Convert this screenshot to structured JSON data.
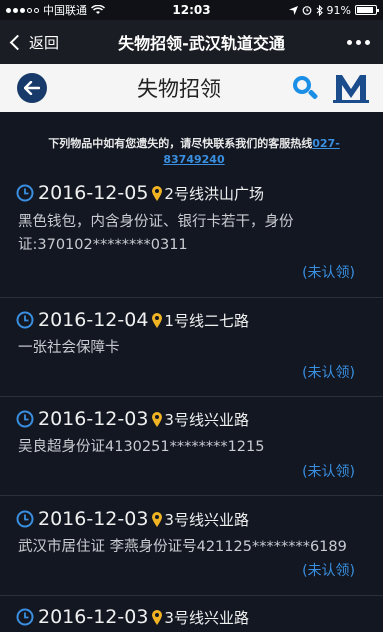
{
  "status_bar": {
    "carrier": "中国联通",
    "time": "12:03",
    "battery": "91%",
    "battery_level": 0.91
  },
  "nav": {
    "back_label": "返回",
    "title": "失物招领-武汉轨道交通"
  },
  "header": {
    "title": "失物招领"
  },
  "notice": {
    "text": "下列物品中如有您遗失的，请尽快联系我们的客服热线",
    "hotline": "027-83749240"
  },
  "items": [
    {
      "date": "2016-12-05",
      "location": "2号线洪山广场",
      "description": "黑色钱包，内含身份证、银行卡若干，身份证:370102********0311",
      "status": "(未认领)"
    },
    {
      "date": "2016-12-04",
      "location": "1号线二七路",
      "description": "一张社会保障卡",
      "status": "(未认领)"
    },
    {
      "date": "2016-12-03",
      "location": "3号线兴业路",
      "description": "吴良超身份证4130251********1215",
      "status": "(未认领)"
    },
    {
      "date": "2016-12-03",
      "location": "3号线兴业路",
      "description": "武汉市居住证 李燕身份证号421125********6189",
      "status": "(未认领)"
    },
    {
      "date": "2016-12-03",
      "location": "3号线兴业路",
      "description": "",
      "status": ""
    }
  ],
  "colors": {
    "background": "#121722",
    "accent": "#3a8fe0",
    "pin": "#f0b323"
  }
}
